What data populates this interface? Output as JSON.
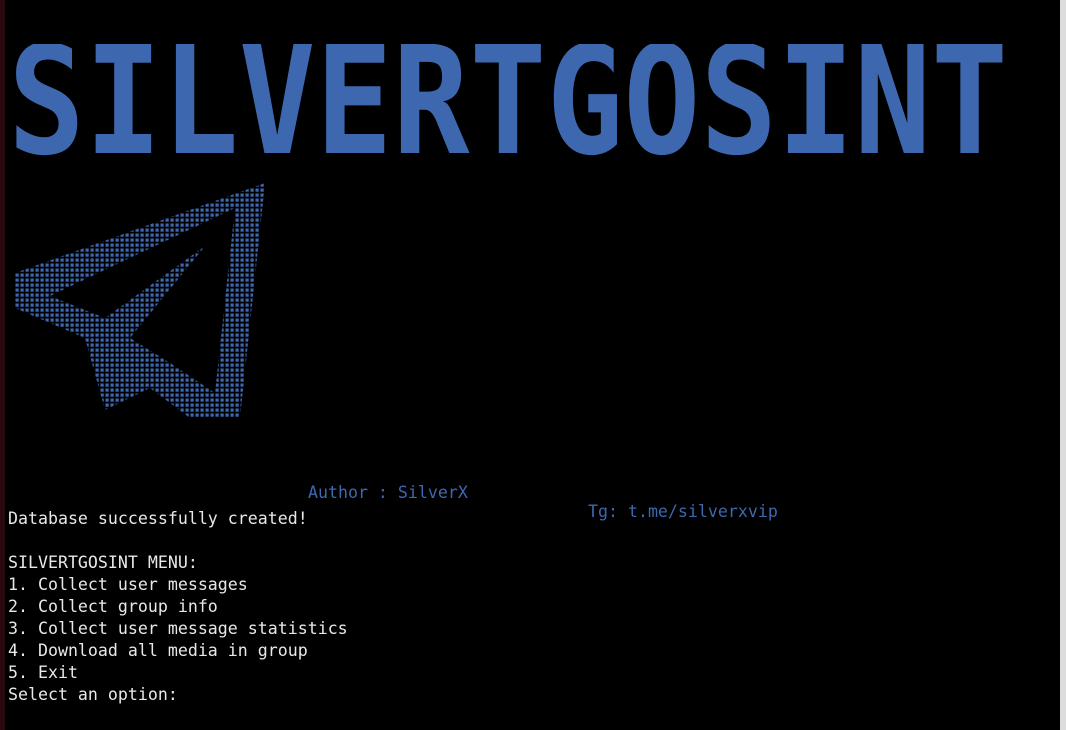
{
  "banner": {
    "text": "SILVERTGOSINT",
    "color": "#3d68b0"
  },
  "logo": {
    "icon": "telegram-paper-plane-icon",
    "color": "#3d68b0"
  },
  "credits": {
    "author": "Author : SilverX",
    "telegram": "Tg: t.me/silverxvip"
  },
  "output": {
    "status": "Database successfully created!",
    "menu_title": "SILVERTGOSINT MENU:",
    "menu_items": [
      "1. Collect user messages",
      "2. Collect group info",
      "3. Collect user message statistics",
      "4. Download all media in group",
      "5. Exit"
    ],
    "prompt": "Select an option:"
  }
}
